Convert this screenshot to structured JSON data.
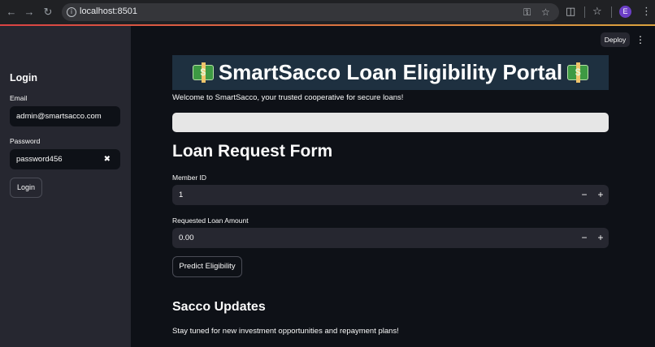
{
  "browser": {
    "url": "localhost:8501",
    "profile_initial": "E",
    "icons": [
      "back-icon",
      "forward-icon",
      "reload-icon",
      "site-info-icon",
      "password-key-icon",
      "bookmark-star-icon",
      "extensions-icon",
      "bookmarks-icon",
      "menu-icon"
    ]
  },
  "header": {
    "deploy_label": "Deploy"
  },
  "sidebar": {
    "title": "Login",
    "email_label": "Email",
    "email_value": "admin@smartsacco.com",
    "password_label": "Password",
    "password_value": "password456",
    "login_label": "Login"
  },
  "main": {
    "banner_title": "SmartSacco Loan Eligibility Portal",
    "welcome": "Welcome to SmartSacco, your trusted cooperative for secure loans!",
    "form_title": "Loan Request Form",
    "member_id_label": "Member ID",
    "member_id_value": "1",
    "loan_amount_label": "Requested Loan Amount",
    "loan_amount_value": "0.00",
    "predict_label": "Predict Eligibility",
    "updates_title": "Sacco Updates",
    "updates_text": "Stay tuned for new investment opportunities and repayment plans!"
  },
  "colors": {
    "app_background": "#0e1117",
    "sidebar_background": "#262730",
    "banner_background": "#1e3040",
    "accent": "#ff4b4b"
  }
}
